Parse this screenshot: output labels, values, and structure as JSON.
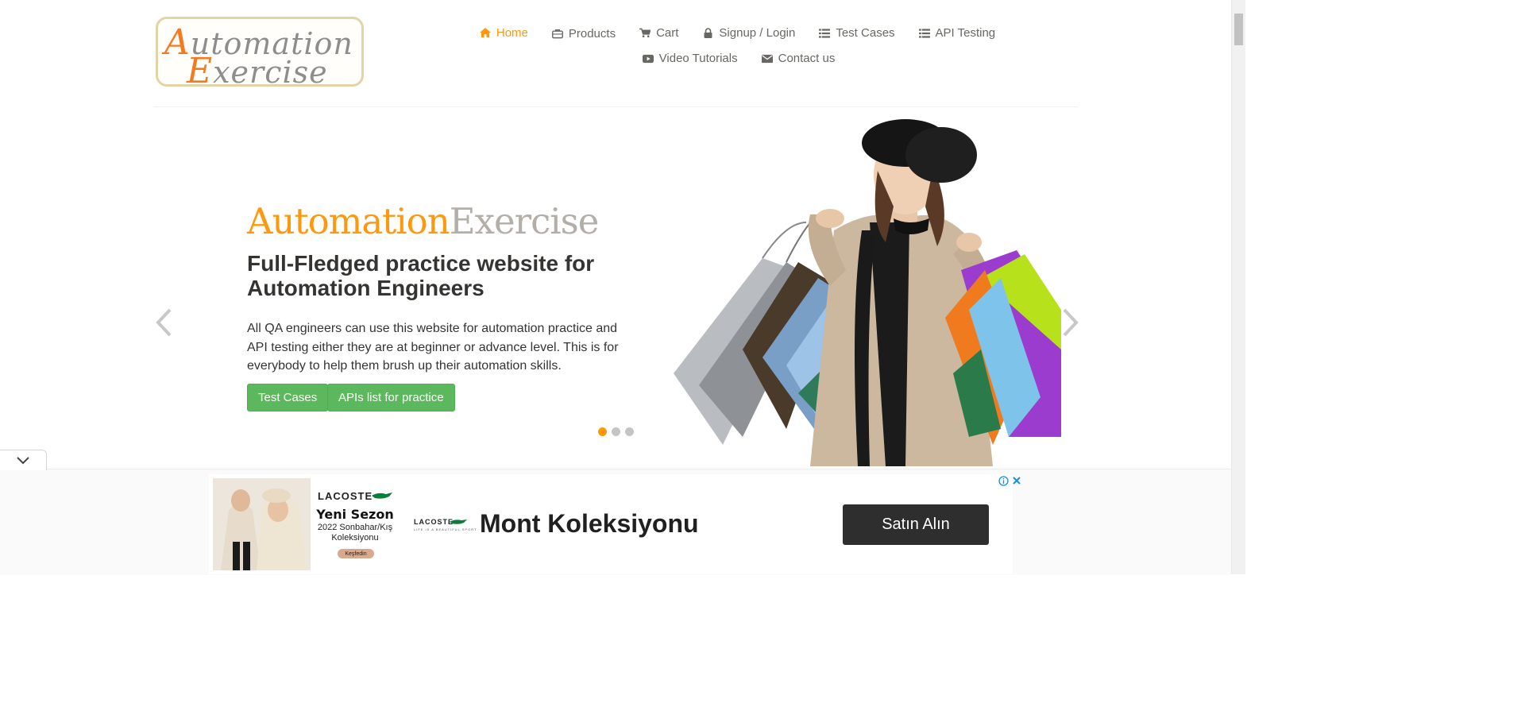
{
  "logo": {
    "line1_cap": "A",
    "line1_rest": "utomation",
    "line2_cap": "E",
    "line2_rest": "xercise"
  },
  "nav": {
    "items": [
      {
        "label": "Home",
        "icon": "home-icon",
        "active": true
      },
      {
        "label": "Products",
        "icon": "briefcase-icon"
      },
      {
        "label": "Cart",
        "icon": "cart-icon"
      },
      {
        "label": "Signup / Login",
        "icon": "lock-icon"
      },
      {
        "label": "Test Cases",
        "icon": "list-icon"
      },
      {
        "label": "API Testing",
        "icon": "list-icon"
      },
      {
        "label": "Video Tutorials",
        "icon": "youtube-play-icon"
      },
      {
        "label": "Contact us",
        "icon": "envelope-icon"
      }
    ]
  },
  "slider": {
    "brand_part1": "Automation",
    "brand_part2": "Exercise",
    "heading": "Full-Fledged practice website for Automation Engineers",
    "text": "All QA engineers can use this website for automation practice and API testing either they are at beginner or advance level. This is for everybody to help them brush up their automation skills.",
    "button_test_cases": "Test Cases",
    "button_apis": "APIs list for practice",
    "slide_count": 3,
    "active_slide": 1
  },
  "colors": {
    "accent": "#fe980f",
    "button_green": "#5cb85c",
    "text_dark": "#363432",
    "nav_text": "#696763"
  },
  "ad": {
    "brand": "LACOSTE",
    "season_title": "Yeni Sezon",
    "season_sub": "2022 Sonbahar/Kış Koleksiyonu",
    "mini_button": "Keşfedin",
    "logo_text": "LACOSTE",
    "logo_tagline": "LIFE IS A BEAUTIFUL SPORT",
    "headline": "Mont Koleksiyonu",
    "cta": "Satın Alın"
  }
}
